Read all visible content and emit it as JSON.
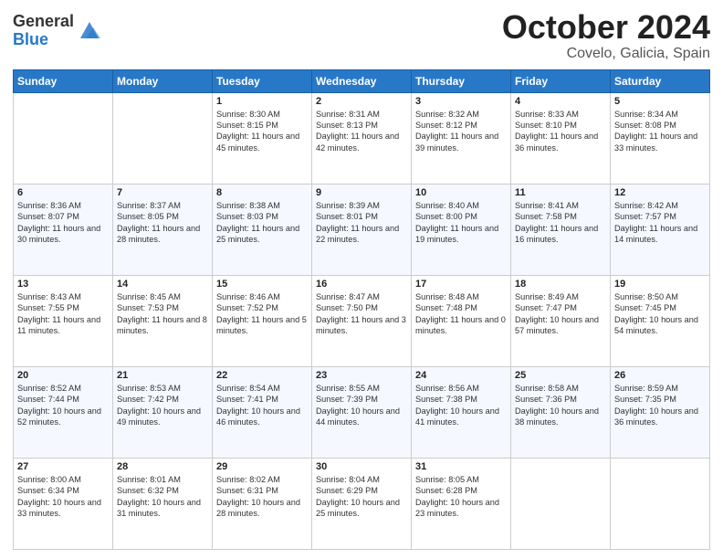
{
  "header": {
    "logo_general": "General",
    "logo_blue": "Blue",
    "month_title": "October 2024",
    "location": "Covelo, Galicia, Spain"
  },
  "weekdays": [
    "Sunday",
    "Monday",
    "Tuesday",
    "Wednesday",
    "Thursday",
    "Friday",
    "Saturday"
  ],
  "weeks": [
    [
      {
        "day": "",
        "sunrise": "",
        "sunset": "",
        "daylight": ""
      },
      {
        "day": "",
        "sunrise": "",
        "sunset": "",
        "daylight": ""
      },
      {
        "day": "1",
        "sunrise": "Sunrise: 8:30 AM",
        "sunset": "Sunset: 8:15 PM",
        "daylight": "Daylight: 11 hours and 45 minutes."
      },
      {
        "day": "2",
        "sunrise": "Sunrise: 8:31 AM",
        "sunset": "Sunset: 8:13 PM",
        "daylight": "Daylight: 11 hours and 42 minutes."
      },
      {
        "day": "3",
        "sunrise": "Sunrise: 8:32 AM",
        "sunset": "Sunset: 8:12 PM",
        "daylight": "Daylight: 11 hours and 39 minutes."
      },
      {
        "day": "4",
        "sunrise": "Sunrise: 8:33 AM",
        "sunset": "Sunset: 8:10 PM",
        "daylight": "Daylight: 11 hours and 36 minutes."
      },
      {
        "day": "5",
        "sunrise": "Sunrise: 8:34 AM",
        "sunset": "Sunset: 8:08 PM",
        "daylight": "Daylight: 11 hours and 33 minutes."
      }
    ],
    [
      {
        "day": "6",
        "sunrise": "Sunrise: 8:36 AM",
        "sunset": "Sunset: 8:07 PM",
        "daylight": "Daylight: 11 hours and 30 minutes."
      },
      {
        "day": "7",
        "sunrise": "Sunrise: 8:37 AM",
        "sunset": "Sunset: 8:05 PM",
        "daylight": "Daylight: 11 hours and 28 minutes."
      },
      {
        "day": "8",
        "sunrise": "Sunrise: 8:38 AM",
        "sunset": "Sunset: 8:03 PM",
        "daylight": "Daylight: 11 hours and 25 minutes."
      },
      {
        "day": "9",
        "sunrise": "Sunrise: 8:39 AM",
        "sunset": "Sunset: 8:01 PM",
        "daylight": "Daylight: 11 hours and 22 minutes."
      },
      {
        "day": "10",
        "sunrise": "Sunrise: 8:40 AM",
        "sunset": "Sunset: 8:00 PM",
        "daylight": "Daylight: 11 hours and 19 minutes."
      },
      {
        "day": "11",
        "sunrise": "Sunrise: 8:41 AM",
        "sunset": "Sunset: 7:58 PM",
        "daylight": "Daylight: 11 hours and 16 minutes."
      },
      {
        "day": "12",
        "sunrise": "Sunrise: 8:42 AM",
        "sunset": "Sunset: 7:57 PM",
        "daylight": "Daylight: 11 hours and 14 minutes."
      }
    ],
    [
      {
        "day": "13",
        "sunrise": "Sunrise: 8:43 AM",
        "sunset": "Sunset: 7:55 PM",
        "daylight": "Daylight: 11 hours and 11 minutes."
      },
      {
        "day": "14",
        "sunrise": "Sunrise: 8:45 AM",
        "sunset": "Sunset: 7:53 PM",
        "daylight": "Daylight: 11 hours and 8 minutes."
      },
      {
        "day": "15",
        "sunrise": "Sunrise: 8:46 AM",
        "sunset": "Sunset: 7:52 PM",
        "daylight": "Daylight: 11 hours and 5 minutes."
      },
      {
        "day": "16",
        "sunrise": "Sunrise: 8:47 AM",
        "sunset": "Sunset: 7:50 PM",
        "daylight": "Daylight: 11 hours and 3 minutes."
      },
      {
        "day": "17",
        "sunrise": "Sunrise: 8:48 AM",
        "sunset": "Sunset: 7:48 PM",
        "daylight": "Daylight: 11 hours and 0 minutes."
      },
      {
        "day": "18",
        "sunrise": "Sunrise: 8:49 AM",
        "sunset": "Sunset: 7:47 PM",
        "daylight": "Daylight: 10 hours and 57 minutes."
      },
      {
        "day": "19",
        "sunrise": "Sunrise: 8:50 AM",
        "sunset": "Sunset: 7:45 PM",
        "daylight": "Daylight: 10 hours and 54 minutes."
      }
    ],
    [
      {
        "day": "20",
        "sunrise": "Sunrise: 8:52 AM",
        "sunset": "Sunset: 7:44 PM",
        "daylight": "Daylight: 10 hours and 52 minutes."
      },
      {
        "day": "21",
        "sunrise": "Sunrise: 8:53 AM",
        "sunset": "Sunset: 7:42 PM",
        "daylight": "Daylight: 10 hours and 49 minutes."
      },
      {
        "day": "22",
        "sunrise": "Sunrise: 8:54 AM",
        "sunset": "Sunset: 7:41 PM",
        "daylight": "Daylight: 10 hours and 46 minutes."
      },
      {
        "day": "23",
        "sunrise": "Sunrise: 8:55 AM",
        "sunset": "Sunset: 7:39 PM",
        "daylight": "Daylight: 10 hours and 44 minutes."
      },
      {
        "day": "24",
        "sunrise": "Sunrise: 8:56 AM",
        "sunset": "Sunset: 7:38 PM",
        "daylight": "Daylight: 10 hours and 41 minutes."
      },
      {
        "day": "25",
        "sunrise": "Sunrise: 8:58 AM",
        "sunset": "Sunset: 7:36 PM",
        "daylight": "Daylight: 10 hours and 38 minutes."
      },
      {
        "day": "26",
        "sunrise": "Sunrise: 8:59 AM",
        "sunset": "Sunset: 7:35 PM",
        "daylight": "Daylight: 10 hours and 36 minutes."
      }
    ],
    [
      {
        "day": "27",
        "sunrise": "Sunrise: 8:00 AM",
        "sunset": "Sunset: 6:34 PM",
        "daylight": "Daylight: 10 hours and 33 minutes."
      },
      {
        "day": "28",
        "sunrise": "Sunrise: 8:01 AM",
        "sunset": "Sunset: 6:32 PM",
        "daylight": "Daylight: 10 hours and 31 minutes."
      },
      {
        "day": "29",
        "sunrise": "Sunrise: 8:02 AM",
        "sunset": "Sunset: 6:31 PM",
        "daylight": "Daylight: 10 hours and 28 minutes."
      },
      {
        "day": "30",
        "sunrise": "Sunrise: 8:04 AM",
        "sunset": "Sunset: 6:29 PM",
        "daylight": "Daylight: 10 hours and 25 minutes."
      },
      {
        "day": "31",
        "sunrise": "Sunrise: 8:05 AM",
        "sunset": "Sunset: 6:28 PM",
        "daylight": "Daylight: 10 hours and 23 minutes."
      },
      {
        "day": "",
        "sunrise": "",
        "sunset": "",
        "daylight": ""
      },
      {
        "day": "",
        "sunrise": "",
        "sunset": "",
        "daylight": ""
      }
    ]
  ]
}
